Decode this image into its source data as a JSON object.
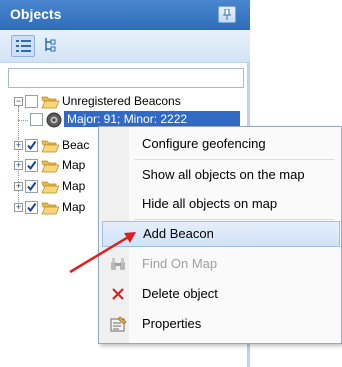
{
  "panel": {
    "title": "Objects"
  },
  "toolbar": {
    "list_view": "list-view",
    "tree_view": "tree-view"
  },
  "search": {
    "value": ""
  },
  "tree": {
    "root_label": "Unregistered Beacons",
    "beacon_label": "Major: 91; Minor: 2222",
    "items": [
      {
        "label": "Beac"
      },
      {
        "label": "Map"
      },
      {
        "label": "Map"
      },
      {
        "label": "Map"
      }
    ]
  },
  "menu": {
    "items": [
      {
        "label": "Configure geofencing"
      },
      {
        "label": "Show all objects on the map"
      },
      {
        "label": "Hide all objects on map"
      },
      {
        "label": "Add Beacon"
      },
      {
        "label": "Find On Map"
      },
      {
        "label": "Delete object"
      },
      {
        "label": "Properties"
      }
    ]
  },
  "colors": {
    "title_bar": "#3a78c5",
    "arrow": "#e02020",
    "highlight": "#d9e8f9"
  }
}
